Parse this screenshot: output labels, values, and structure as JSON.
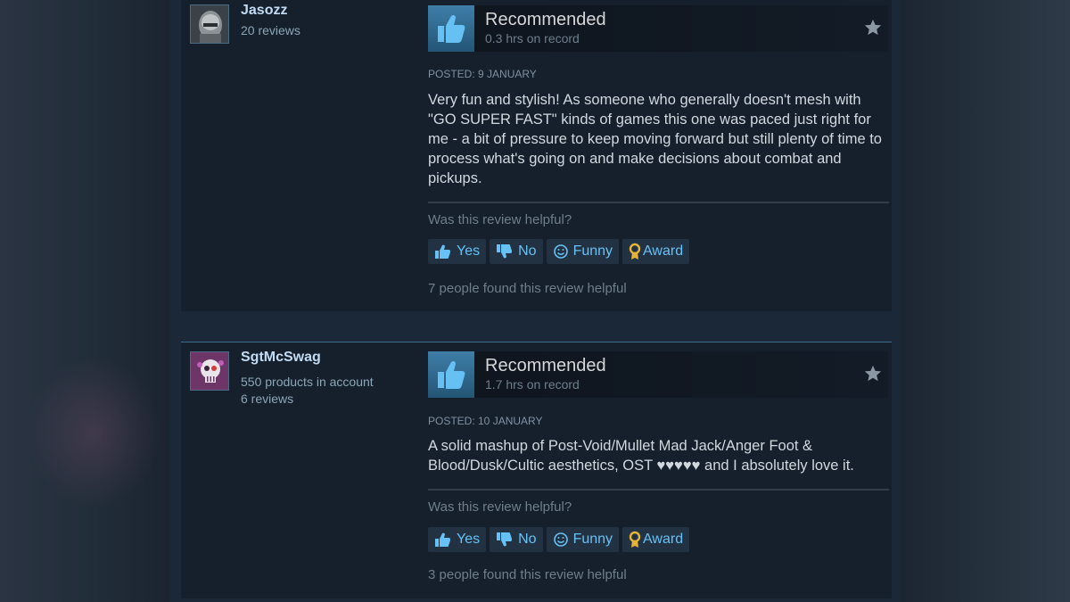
{
  "reviews": [
    {
      "author": {
        "name": "Jasozz",
        "lines": [
          "20 reviews"
        ]
      },
      "verdict": "Recommended",
      "hours": "0.3 hrs on record",
      "posted": "POSTED: 9 JANUARY",
      "text": "Very fun and stylish! As someone who generally doesn't mesh with \"GO SUPER FAST\" kinds of games this one was paced just right for me - a bit of pressure to keep moving forward but still plenty of time to process what's going on and make decisions about combat and pickups.",
      "helpful_question": "Was this review helpful?",
      "buttons": {
        "yes": "Yes",
        "no": "No",
        "funny": "Funny",
        "award": "Award"
      },
      "helpful_count": "7 people found this review helpful"
    },
    {
      "author": {
        "name": "SgtMcSwag",
        "lines": [
          "550 products in account",
          "6 reviews"
        ]
      },
      "verdict": "Recommended",
      "hours": "1.7 hrs on record",
      "posted": "POSTED: 10 JANUARY",
      "text": "A solid mashup of Post-Void/Mullet Mad Jack/Anger Foot & Blood/Dusk/Cultic aesthetics, OST ♥♥♥♥♥ and I absolutely love it.",
      "helpful_question": "Was this review helpful?",
      "buttons": {
        "yes": "Yes",
        "no": "No",
        "funny": "Funny",
        "award": "Award"
      },
      "helpful_count": "3 people found this review helpful"
    }
  ],
  "colors": {
    "page_bg": "#1b2838",
    "card_bg": "#16202d",
    "link_blue": "#67c1f5",
    "author_name": "#c1dbf4",
    "thumb_up": "#66c0f4",
    "award_gold": "#e7b43a"
  },
  "icons": {
    "thumb": "thumbs-up-icon",
    "star": "star-icon",
    "yes": "thumbs-up-small-icon",
    "no": "thumbs-down-small-icon",
    "funny": "smiley-icon",
    "award": "award-ribbon-icon"
  }
}
